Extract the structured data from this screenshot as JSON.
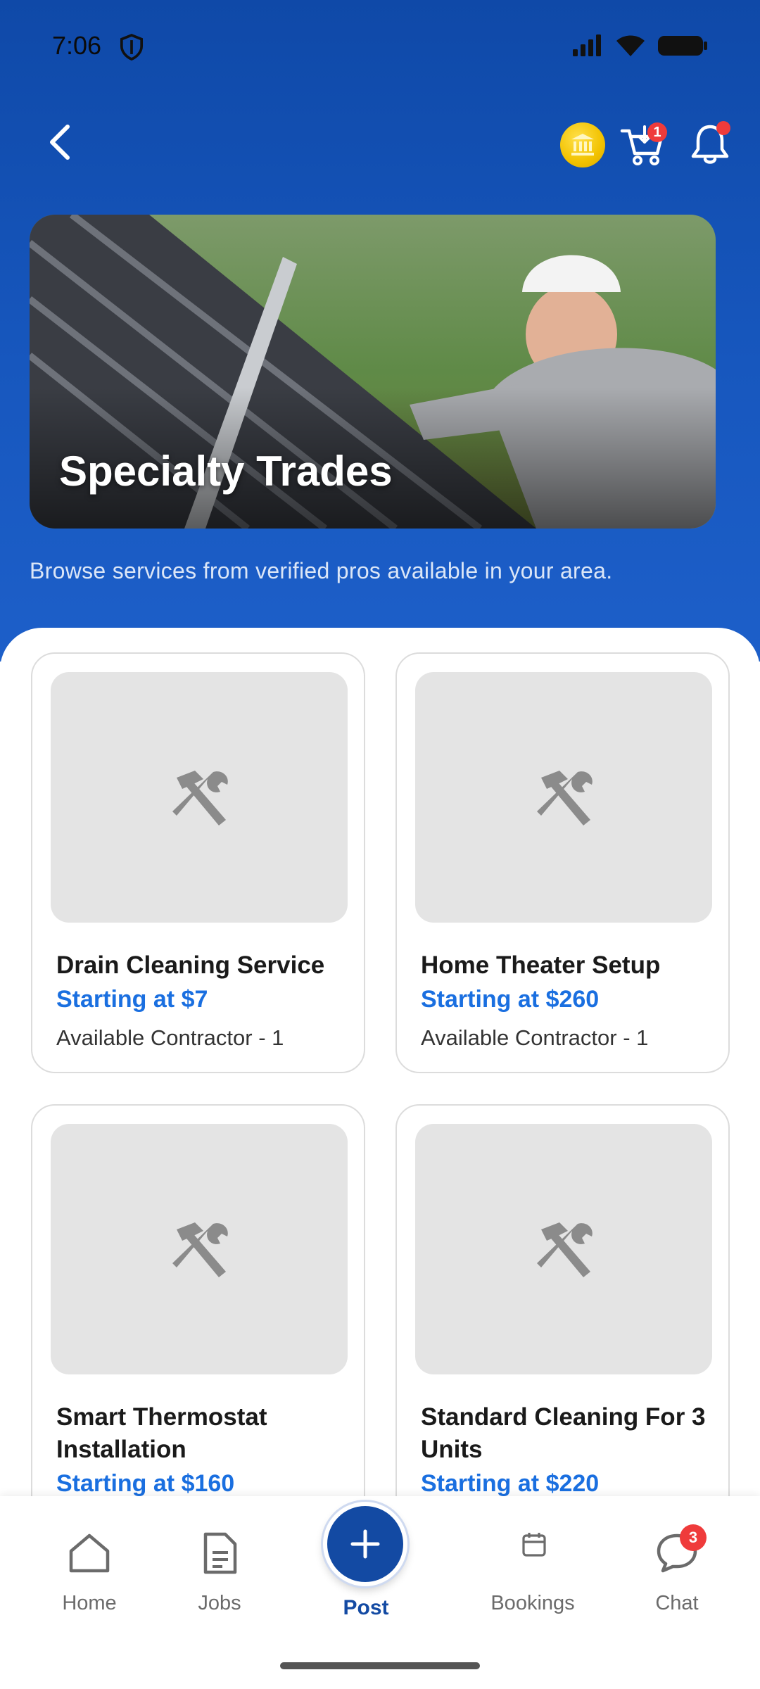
{
  "status": {
    "time": "7:06"
  },
  "header": {
    "cart_badge": "1"
  },
  "banner": {
    "title": "Specialty Trades"
  },
  "subtitle": "Browse services from verified pros available in your area.",
  "services": [
    {
      "title": "Drain Cleaning Service",
      "price": "Starting at $7",
      "availability": "Available Contractor - 1"
    },
    {
      "title": "Home Theater Setup",
      "price": "Starting at $260",
      "availability": "Available Contractor - 1"
    },
    {
      "title": "Smart Thermostat Installation",
      "price": "Starting at $160",
      "availability": ""
    },
    {
      "title": "Standard Cleaning For 3 Units",
      "price": "Starting at $220",
      "availability": ""
    }
  ],
  "nav": {
    "home": "Home",
    "jobs": "Jobs",
    "post": "Post",
    "bookings": "Bookings",
    "chat": "Chat",
    "chat_badge": "3"
  },
  "colors": {
    "primary": "#134aa3",
    "accent_price": "#1a6fe0",
    "badge": "#ef3b3b"
  }
}
